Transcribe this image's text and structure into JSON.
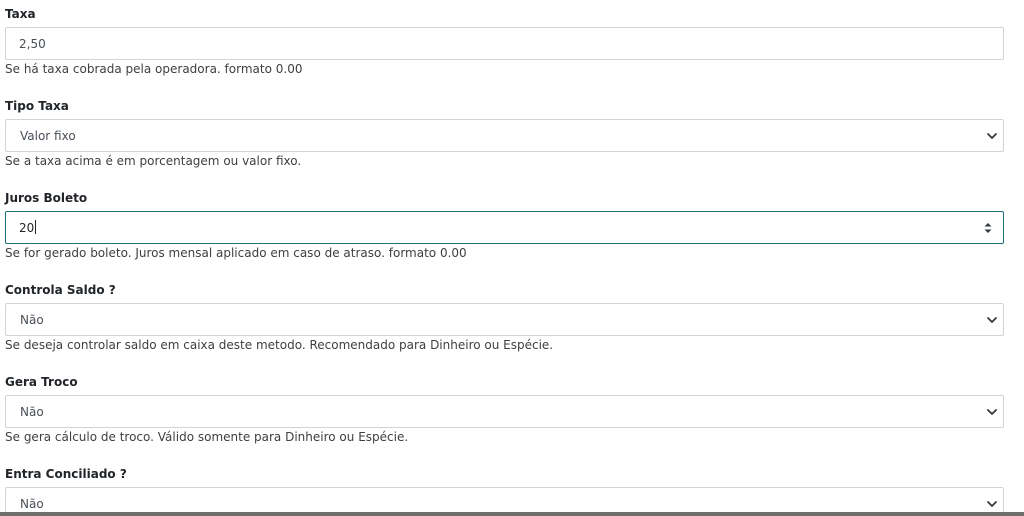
{
  "fields": [
    {
      "label": "Taxa",
      "value": "2,50",
      "help": "Se há taxa cobrada pela operadora. formato 0.00"
    },
    {
      "label": "Tipo Taxa",
      "value": "Valor fixo",
      "help": "Se a taxa acima é em porcentagem ou valor fixo."
    },
    {
      "label": "Juros Boleto",
      "value": "20",
      "help": "Se for gerado boleto. Juros mensal aplicado em caso de atraso. formato 0.00"
    },
    {
      "label": "Controla Saldo ?",
      "value": "Não",
      "help": "Se deseja controlar saldo em caixa deste metodo. Recomendado para Dinheiro ou Espécie."
    },
    {
      "label": "Gera Troco",
      "value": "Não",
      "help": "Se gera cálculo de troco. Válido somente para Dinheiro ou Espécie."
    },
    {
      "label": "Entra Conciliado ?",
      "value": "Não"
    }
  ],
  "icons": {
    "select": "chevron-down-icon",
    "number": "spinner-arrows-icon"
  }
}
